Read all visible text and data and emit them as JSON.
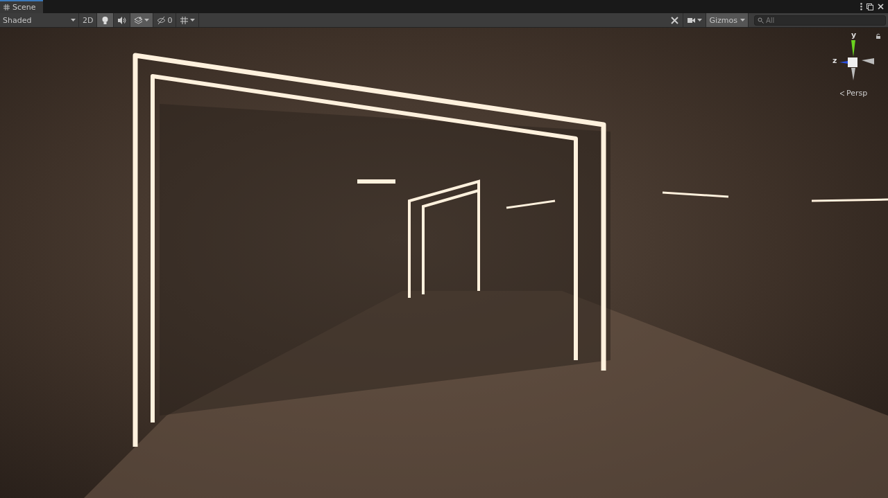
{
  "tabs": [
    {
      "label": "Scene",
      "selected": true
    }
  ],
  "toolbar_left": [
    {
      "kind": "dropdown",
      "label": "Shaded"
    },
    {
      "kind": "toggle",
      "label": "2D",
      "on": false
    },
    {
      "kind": "icon-toggle",
      "on": true
    },
    {
      "kind": "icon-toggle",
      "on": false
    },
    {
      "kind": "icon-dropdown",
      "on": true
    },
    {
      "kind": "counter",
      "label": "0"
    },
    {
      "kind": "icon-dropdown",
      "on": false
    }
  ],
  "toolbar_right": [
    {
      "kind": "icon-toggle",
      "on": false
    },
    {
      "kind": "icon-dropdown",
      "on": false
    },
    {
      "kind": "dropdown-toggle",
      "label": "Gizmos",
      "on": true
    }
  ],
  "search": {
    "placeholder": "All"
  },
  "gizmo": {
    "axes": [
      {
        "label": "y"
      },
      {
        "label": "z"
      }
    ],
    "projection": "Persp",
    "locked": false
  }
}
